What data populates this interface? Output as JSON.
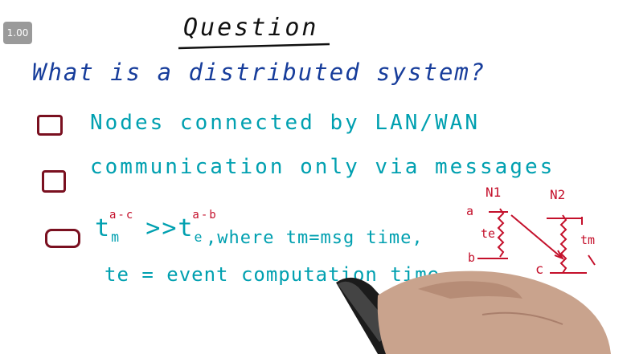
{
  "speed_badge": "1.00",
  "title": "Question",
  "question": "What is a distributed system?",
  "options": [
    {
      "text": "Nodes connected by LAN/WAN"
    },
    {
      "text": "communication only via messages"
    }
  ],
  "option3": {
    "t_m": "t",
    "m_sub": "m",
    "m_sup": "a-c",
    "gt": ">>",
    "t_e": "t",
    "e_sub": "e",
    "e_sup": "a-b",
    "rest": ",where tm=msg time,",
    "line2": "te = event computation time"
  },
  "diagram": {
    "n1": "N1",
    "n2": "N2",
    "a": "a",
    "b": "b",
    "c": "c",
    "te": "te",
    "tm": "tm"
  }
}
